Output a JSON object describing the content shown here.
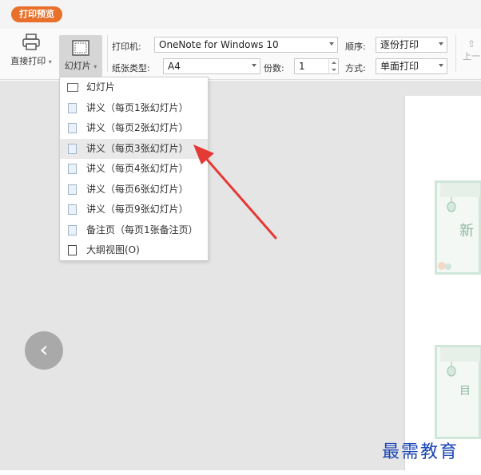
{
  "titlebar": {
    "preview_tab": "打印预览"
  },
  "toolbar": {
    "direct_print": "直接打印",
    "slides_mode": "幻灯片",
    "printer_label": "打印机:",
    "printer_value": "OneNote for Windows 10",
    "order_label": "顺序:",
    "order_value": "逐份打印",
    "paper_label": "纸张类型:",
    "paper_value": "A4",
    "copies_label": "份数:",
    "copies_value": "1",
    "mode_label": "方式:",
    "mode_value": "单面打印",
    "prev_page_partial": "上一"
  },
  "dropdown": {
    "items": [
      {
        "label": "幻灯片",
        "icon": "slide-icon"
      },
      {
        "label": "讲义（每页1张幻灯片）",
        "icon": "handout-1-icon"
      },
      {
        "label": "讲义（每页2张幻灯片）",
        "icon": "handout-2-icon"
      },
      {
        "label": "讲义（每页3张幻灯片）",
        "icon": "handout-3-icon",
        "selected": true
      },
      {
        "label": "讲义（每页4张幻灯片）",
        "icon": "handout-4-icon"
      },
      {
        "label": "讲义（每页6张幻灯片）",
        "icon": "handout-6-icon"
      },
      {
        "label": "讲义（每页9张幻灯片）",
        "icon": "handout-9-icon"
      },
      {
        "label": "备注页（每页1张备注页）",
        "icon": "notes-page-icon"
      },
      {
        "label": "大纲视图(O)",
        "icon": "outline-icon"
      }
    ]
  },
  "preview": {
    "thumb1_char": "新",
    "thumb2_char": "目"
  },
  "nav": {
    "prev_glyph": "‹"
  },
  "watermark": "最需教育",
  "colors": {
    "accent": "#e8702a",
    "arrow": "#e53935",
    "watermark": "#1b46b5"
  }
}
